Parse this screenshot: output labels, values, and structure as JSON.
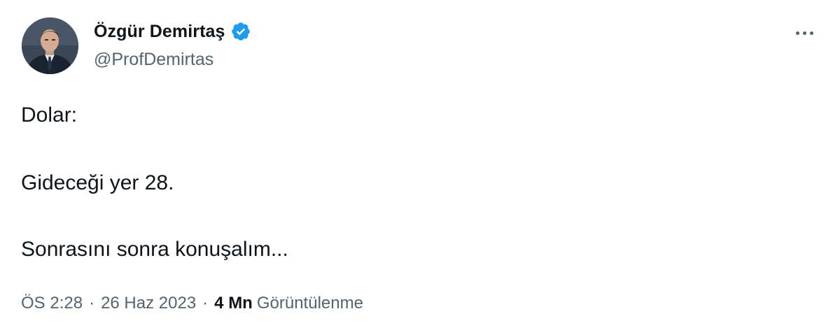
{
  "author": {
    "display_name": "Özgür Demirtaş",
    "handle": "@ProfDemirtas",
    "verified_icon": "verified-badge-icon",
    "verified_color": "#1d9bf0",
    "avatar_icon": "profile-photo"
  },
  "more_icon": "more-horizontal-icon",
  "tweet": {
    "lines": [
      "Dolar:",
      "Gideceği yer 28.",
      "Sonrasını sonra konuşalım..."
    ]
  },
  "meta": {
    "time": "ÖS 2:28",
    "separator": "·",
    "date": "26 Haz 2023",
    "views_count": "4 Mn",
    "views_label": "Görüntülenme"
  },
  "colors": {
    "text": "#0f1419",
    "secondary": "#536471",
    "accent": "#1d9bf0"
  }
}
